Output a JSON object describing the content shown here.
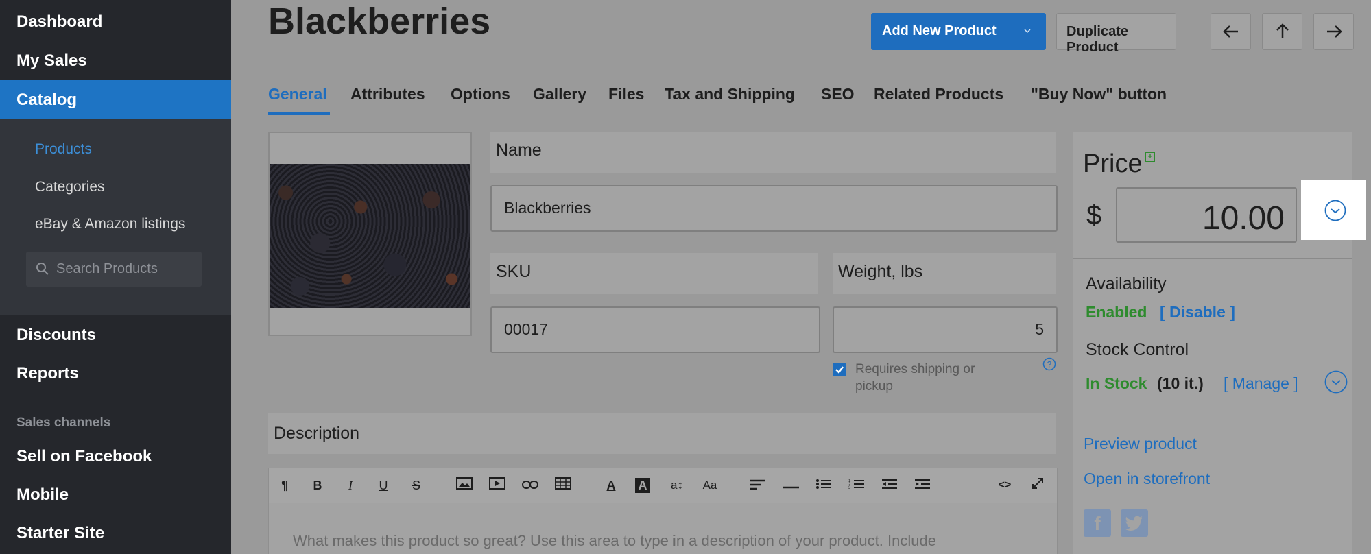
{
  "sidebar": {
    "items_top": [
      "Dashboard",
      "My Sales",
      "Catalog"
    ],
    "sub_items": [
      "Products",
      "Categories",
      "eBay & Amazon listings"
    ],
    "search_placeholder": "Search Products",
    "items_bottom": [
      "Discounts",
      "Reports"
    ],
    "section_label": "Sales channels",
    "channels": [
      "Sell on Facebook",
      "Mobile",
      "Starter Site"
    ]
  },
  "header": {
    "title": "Blackberries",
    "add_new": "Add New Product",
    "duplicate": "Duplicate Product"
  },
  "tabs": [
    "General",
    "Attributes",
    "Options",
    "Gallery",
    "Files",
    "Tax and Shipping",
    "SEO",
    "Related Products",
    "\"Buy Now\" button"
  ],
  "form": {
    "name_label": "Name",
    "name_value": "Blackberries",
    "sku_label": "SKU",
    "sku_value": "00017",
    "weight_label": "Weight, lbs",
    "weight_value": "5",
    "shipping_checkbox": "Requires shipping or pickup",
    "shipping_checked": true,
    "description_label": "Description",
    "description_placeholder": "What makes this product so great? Use this area to type in a description of your product. Include"
  },
  "price_panel": {
    "title": "Price",
    "currency": "$",
    "value": "10.00",
    "availability_label": "Availability",
    "availability_status": "Enabled",
    "availability_action": "[ Disable ]",
    "stock_label": "Stock Control",
    "stock_status": "In Stock",
    "stock_count": "(10 it.)",
    "stock_action": "[ Manage ]",
    "preview": "Preview product",
    "open_storefront": "Open in storefront"
  },
  "colors": {
    "accent": "#1e6dbe",
    "success": "#2e8b2e",
    "sidebar_bg": "#25272c"
  }
}
